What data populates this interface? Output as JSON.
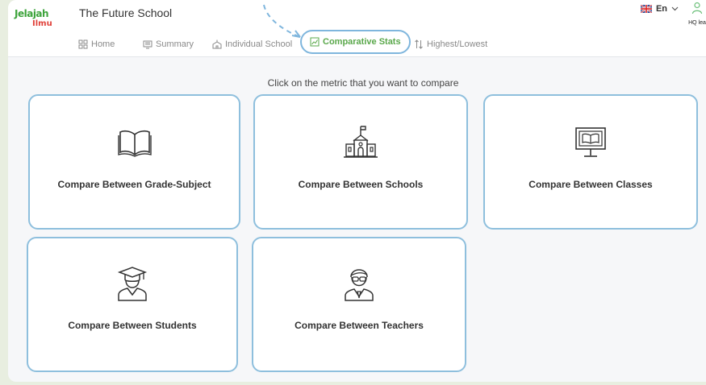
{
  "logo": {
    "line1": "Jelajah",
    "line2": "Ilmu"
  },
  "school": {
    "name": "The Future School"
  },
  "nav": {
    "tabs": [
      {
        "label": "Home",
        "icon": "grid-icon"
      },
      {
        "label": "Summary",
        "icon": "monitor-icon"
      },
      {
        "label": "Individual School",
        "icon": "school-icon"
      },
      {
        "label": "Comparative Stats",
        "icon": "chart-icon",
        "active": true
      },
      {
        "label": "Highest/Lowest",
        "icon": "sort-arrows-icon"
      }
    ]
  },
  "language": {
    "code": "En",
    "flag": "uk-flag-icon"
  },
  "user": {
    "role": "HQ leader"
  },
  "main": {
    "instruction": "Click on the metric that you want to compare",
    "cards": [
      {
        "label": "Compare Between Grade-Subject",
        "icon": "book-icon"
      },
      {
        "label": "Compare Between Schools",
        "icon": "school-building-icon"
      },
      {
        "label": "Compare Between Classes",
        "icon": "classroom-board-icon"
      },
      {
        "label": "Compare Between Students",
        "icon": "graduate-student-icon"
      },
      {
        "label": "Compare Between Teachers",
        "icon": "teacher-icon"
      }
    ]
  },
  "colors": {
    "accent": "#5aa84b",
    "card_border": "#8ebfdd",
    "brand_green": "#3da33b",
    "brand_red": "#e0413a"
  }
}
